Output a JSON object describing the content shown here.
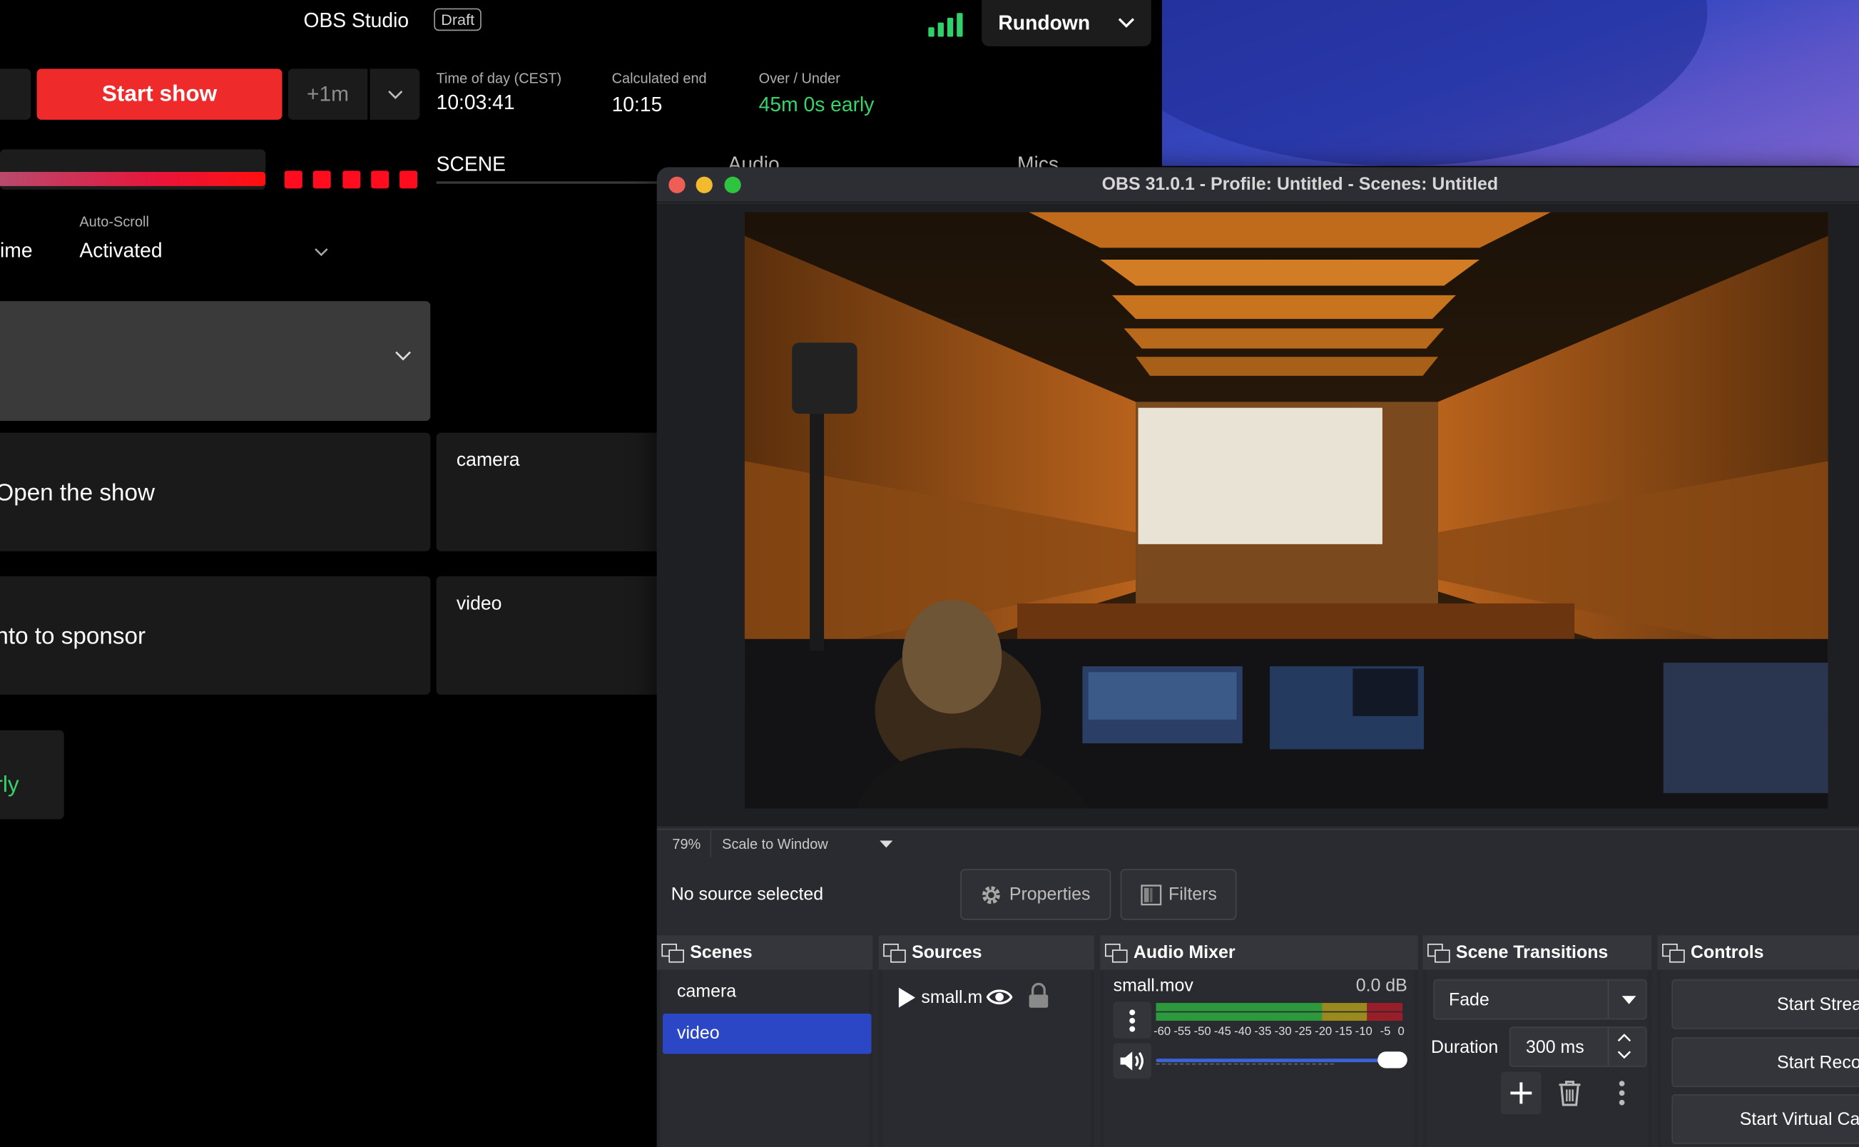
{
  "rundown": {
    "app_title": "OBS Studio",
    "status_badge": "Draft",
    "view_dropdown": "Rundown",
    "start_button": "Start show",
    "add_minute_button": "+1m",
    "time_of_day": {
      "label": "Time of day (CEST)",
      "value": "10:03:41"
    },
    "calculated_end": {
      "label": "Calculated end",
      "value": "10:15"
    },
    "over_under": {
      "label": "Over / Under",
      "value": "45m 0s early"
    },
    "progress_fraction": 1.0,
    "columns": [
      "SCENE",
      "Audio",
      "Mics"
    ],
    "time_stub": "ime",
    "auto_scroll": {
      "label": "Auto-Scroll",
      "value": "Activated"
    },
    "rows": [
      {
        "title": "Open the show",
        "scene": "camera"
      },
      {
        "title": "nto to sponsor",
        "scene": "video"
      }
    ],
    "early_stub": "rly",
    "colors": {
      "start": "#ee2a2a",
      "early": "#38d36b",
      "signal": "#2fd16b"
    }
  },
  "obs": {
    "window_title": "OBS 31.0.1 - Profile: Untitled - Scenes: Untitled",
    "zoom": "79%",
    "scale_mode": "Scale to Window",
    "no_source": "No source selected",
    "properties_button": "Properties",
    "filters_button": "Filters",
    "docks": {
      "scenes": "Scenes",
      "sources": "Sources",
      "audio_mixer": "Audio Mixer",
      "scene_transitions": "Scene Transitions",
      "controls": "Controls"
    },
    "scenes": [
      "camera",
      "video"
    ],
    "selected_scene": "video",
    "sources": [
      {
        "name": "small.m"
      }
    ],
    "audio": {
      "source": "small.mov",
      "db": "0.0 dB",
      "ticks": [
        "-60",
        "-55",
        "-50",
        "-45",
        "-40",
        "-35",
        "-30",
        "-25",
        "-20",
        "-15",
        "-10",
        "-5",
        "0"
      ],
      "volume_fraction": 1.0
    },
    "transitions": {
      "type": "Fade",
      "duration_label": "Duration",
      "duration": "300 ms"
    },
    "controls": [
      "Start Streaming",
      "Start Recording",
      "Start Virtual Camera"
    ],
    "colors": {
      "selected": "#2c47c5",
      "meter_green": "#2c9a3c",
      "meter_yellow": "#9a8a1e",
      "meter_red": "#9a1e2a"
    }
  }
}
